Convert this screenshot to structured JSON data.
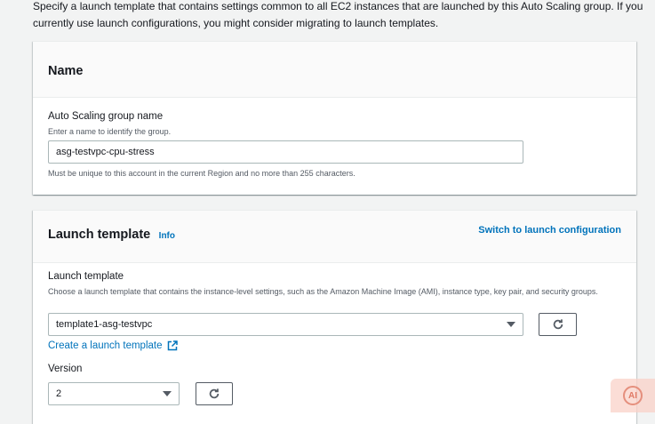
{
  "intro_text": "Specify a launch template that contains settings common to all EC2 instances that are launched by this Auto Scaling group. If you currently use launch configurations, you might consider migrating to launch templates.",
  "name_section": {
    "title": "Name",
    "field_label": "Auto Scaling group name",
    "field_description": "Enter a name to identify the group.",
    "field_value": "asg-testvpc-cpu-stress",
    "constraint_text": "Must be unique to this account in the current Region and no more than 255 characters."
  },
  "launch_template_section": {
    "title": "Launch template",
    "info_label": "Info",
    "switch_link": "Switch to launch configuration",
    "field_label": "Launch template",
    "field_description": "Choose a launch template that contains the instance-level settings, such as the Amazon Machine Image (AMI), instance type, key pair, and security groups.",
    "selected_template": "template1-asg-testvpc",
    "create_link": "Create a launch template",
    "version_label": "Version",
    "selected_version": "2"
  },
  "icons": {
    "refresh": "refresh-icon",
    "external_link": "external-link-icon",
    "dropdown": "caret-down-icon"
  },
  "badge_text": "AI",
  "colors": {
    "link": "#0073bb",
    "background": "#f2f3f3",
    "card": "#ffffff"
  }
}
